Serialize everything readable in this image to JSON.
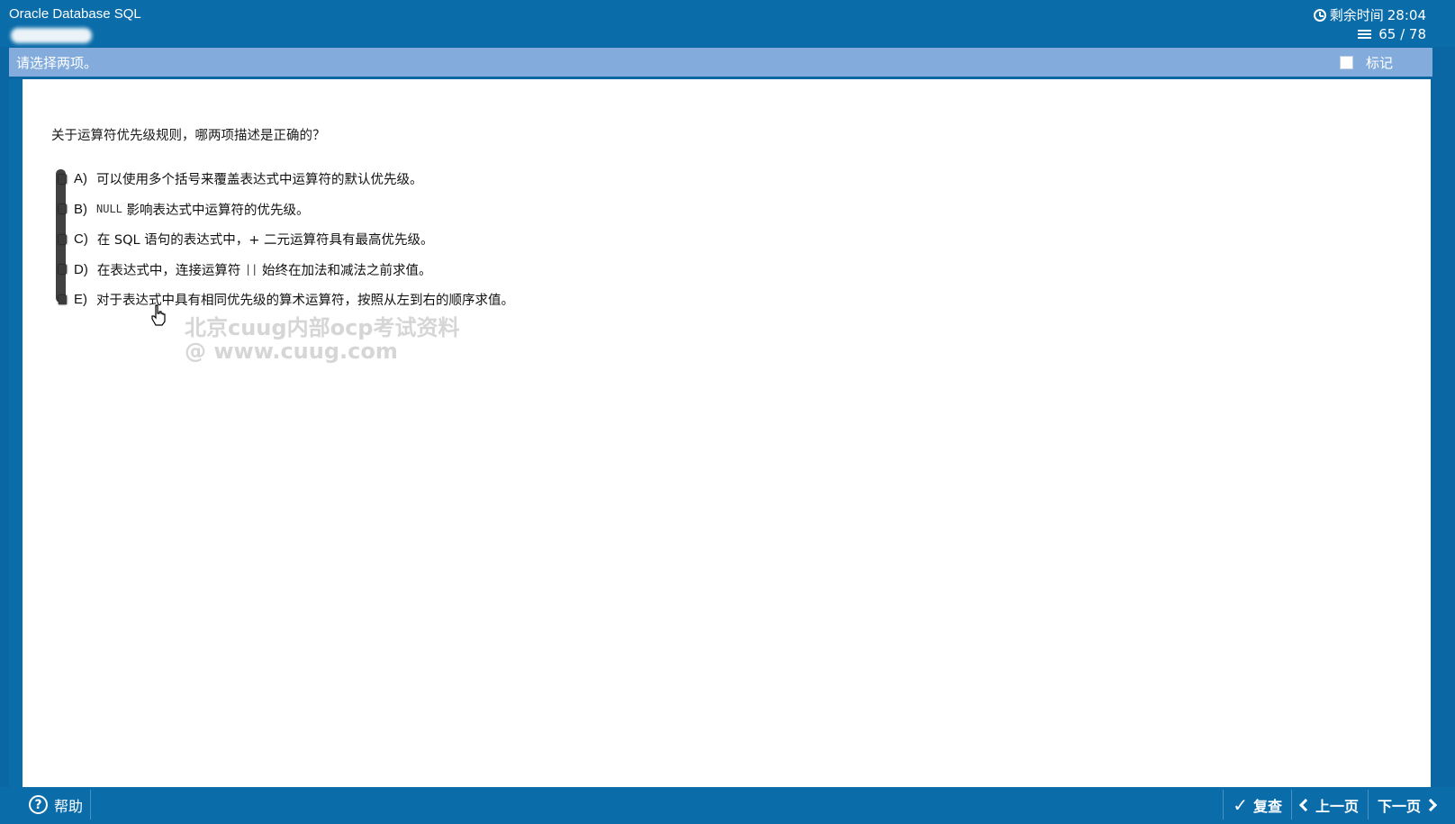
{
  "header": {
    "app_title": "Oracle Database SQL",
    "timer_label": "剩余时间",
    "timer_value": "28:04",
    "progress_value": "65 / 78"
  },
  "instruction": {
    "text": "请选择两项。",
    "mark_label": "标记"
  },
  "question": {
    "text": "关于运算符优先级规则，哪两项描述是正确的？",
    "options": [
      {
        "letter": "A)",
        "text": "可以使用多个括号来覆盖表达式中运算符的默认优先级。"
      },
      {
        "letter": "B)",
        "code": "NULL",
        "text": "影响表达式中运算符的优先级。"
      },
      {
        "letter": "C)",
        "text": "在 SQL 语句的表达式中，+ 二元运算符具有最高优先级。"
      },
      {
        "letter": "D)",
        "text_pre": "在表达式中，连接运算符",
        "code": "||",
        "text_post": "始终在加法和减法之前求值。"
      },
      {
        "letter": "E)",
        "text": "对于表达式中具有相同优先级的算术运算符，按照从左到右的顺序求值。"
      }
    ]
  },
  "watermark": {
    "line1": "北京cuug内部ocp考试资料",
    "line2": "@ www.cuug.com"
  },
  "footer": {
    "help_label": "帮助",
    "review_label": "复查",
    "prev_label": "上一页",
    "next_label": "下一页"
  }
}
